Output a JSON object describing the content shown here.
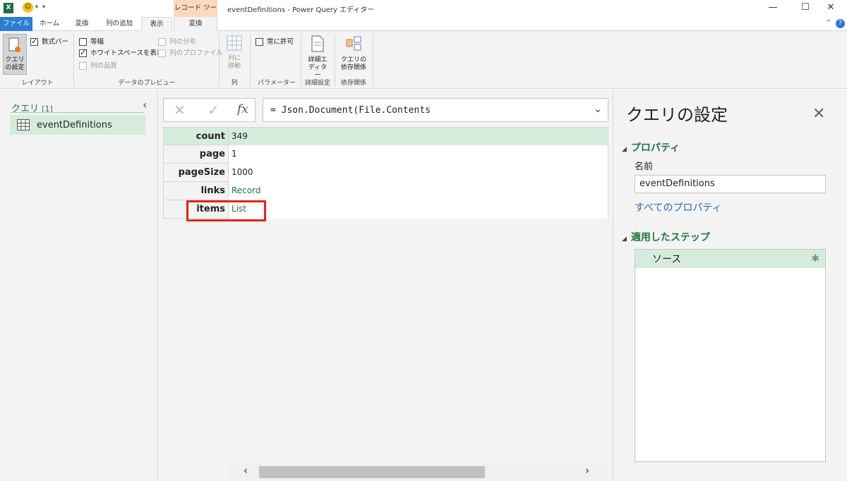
{
  "window": {
    "title": "eventDefinitions - Power Query エディター",
    "minimize": "—",
    "maximize": "☐",
    "close": "✕"
  },
  "ribbon": {
    "context_group": "レコード ツール",
    "tabs": [
      "ファイル",
      "ホーム",
      "変換",
      "列の追加",
      "表示"
    ],
    "context_tab": "変換",
    "layout_group": {
      "label": "レイアウト",
      "query_settings": "クエリの設定",
      "formula_bar": "数式バー"
    },
    "preview_group": {
      "label": "データのプレビュー",
      "monospace": "等幅",
      "show_whitespace": "ホワイトスペースを表示",
      "column_quality": "列の品質",
      "column_distribution": "列の分布",
      "column_profile": "列のプロファイル"
    },
    "columns_group": {
      "label": "列",
      "goto_column": "列に移動"
    },
    "params_group": {
      "label": "パラメーター",
      "always_allow": "常に許可"
    },
    "advanced_group": {
      "label": "詳細設定",
      "advanced_editor": "詳細エディター"
    },
    "deps_group": {
      "label": "依存関係",
      "query_deps": "クエリの依存関係"
    }
  },
  "queries": {
    "header": "クエリ",
    "count": "[1]",
    "items": [
      {
        "name": "eventDefinitions"
      }
    ]
  },
  "formula": {
    "text": "= Json.Document(File.Contents"
  },
  "record": [
    {
      "key": "count",
      "value": "349"
    },
    {
      "key": "page",
      "value": "1"
    },
    {
      "key": "pageSize",
      "value": "1000"
    },
    {
      "key": "links",
      "value": "Record"
    },
    {
      "key": "items",
      "value": "List"
    }
  ],
  "settings": {
    "title": "クエリの設定",
    "properties_header": "プロパティ",
    "name_label": "名前",
    "name_value": "eventDefinitions",
    "all_properties": "すべてのプロパティ",
    "steps_header": "適用したステップ",
    "steps": [
      {
        "name": "ソース"
      }
    ]
  },
  "colors": {
    "accent_green": "#217346",
    "file_tab": "#2b7cd3",
    "context_tab": "#fbd9bd",
    "highlight": "#e2231a",
    "selected_row": "#d5ecdd"
  }
}
